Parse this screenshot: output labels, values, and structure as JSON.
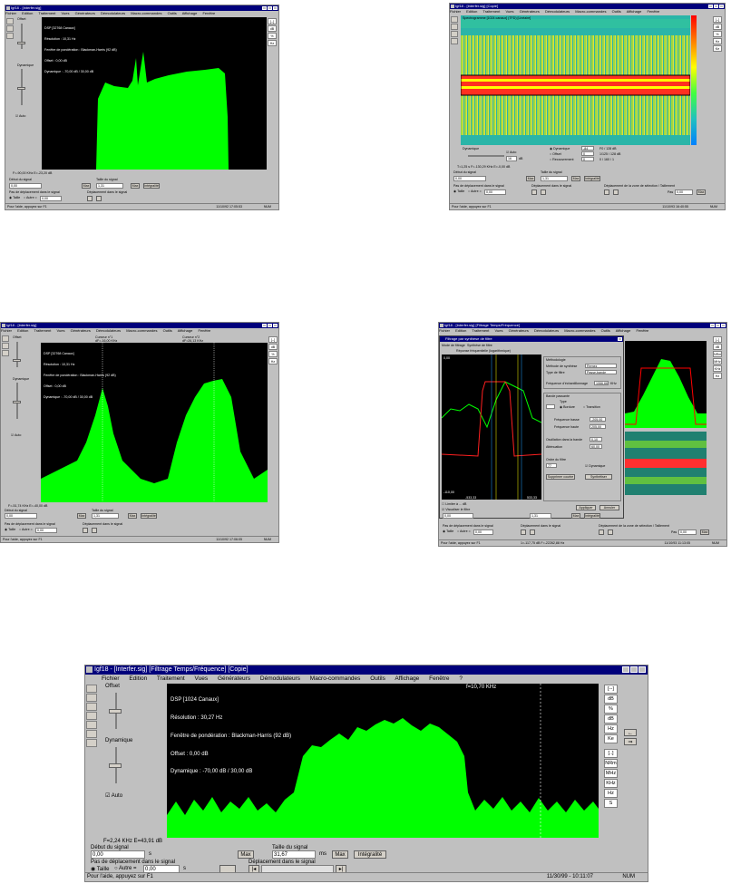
{
  "menu": [
    "Fichier",
    "Edition",
    "Traitement",
    "Vues",
    "Générateurs",
    "Démodulateurs",
    "Macro-commandes",
    "Outils",
    "Affichage",
    "Fenêtre",
    "?"
  ],
  "right_buttons": [
    "[--]",
    "dB",
    "%",
    "dB",
    "Hz",
    "Ke",
    "[..]",
    "NRm",
    "MHz",
    "KHz",
    "Hz",
    "S"
  ],
  "status_help": "Pour l'aide, appuyez sur F1",
  "status_num": "NUM",
  "windows": [
    {
      "title": "Igf18 - [Interfer.sig]",
      "offset_label": "Offset",
      "dynamic_label": "Dynamique",
      "auto_label": "Auto",
      "overlay": [
        "DSP [32768 Canaux]",
        "Résolution : 10,31 Hz",
        "Fenêtre de pondération : Blackman-Harris (92 dB)",
        "Offset : 0,00 dB",
        "Dynamique : -70,00 dB / 30,00 dB"
      ],
      "cursor_readout": "F=-90,00 KHz  E=-23,20 dB",
      "debut_label": "Début du signal",
      "debut_value": "0,00",
      "taille_label": "Taille du signal",
      "taille_value": "1,31",
      "max_btn": "Max",
      "integ_btn": "Intégralité",
      "pas_label": "Pas de déplacement dans le signal",
      "taille_radio": "Taille",
      "autre_radio": "Autre =",
      "pas_value": "0,00",
      "depl_label": "Déplacement dans le signal",
      "time": "11/10/92 17:05:53"
    },
    {
      "title": "Igf18 - [Interfer.sig] [Copie]",
      "spectro_header": "Spectrogramme [1024 canaux] (TFD) [Linéaire]",
      "dynamic_label": "Dynamique",
      "auto_label": "Auto",
      "dyn_value": "16",
      "db_unit": "dB",
      "mode1": "Dynamique",
      "mode2": "Offset",
      "mode3": "Recouvrement",
      "v1": "-84",
      "v2": "0",
      "v3": "0",
      "info1": "F0 / 128 dB",
      "info2": "1/125 / 128 dB",
      "info3": "0 / 160 / 1",
      "cursor_readout": "T=1,25 s  F=-130,29 KHz  E=-0,00 dB",
      "debut_label": "Début du signal",
      "debut_value": "0,00",
      "taille_label": "Taille du signal",
      "taille_value": "1,31",
      "max_btn": "Max",
      "integ_btn": "Intégralité",
      "pas_label": "Pas de déplacement dans le signal",
      "taille_radio": "Taille",
      "autre_radio": "Autre =",
      "pas_value": "0,00",
      "depl_label": "Déplacement dans le signal",
      "zone_label": "Déplacement de la zone de sélection / Taillement",
      "pas_short": "Pas",
      "zone_value": "0,00",
      "time": "11/10/93 16:40:55"
    },
    {
      "title": "Igf18 - [Interfer.sig]",
      "offset_label": "Offset",
      "dynamic_label": "Dynamique",
      "auto_label": "Auto",
      "cursor1": "Curseur n°1",
      "cursor1_f": "dF=-16,00 KHz",
      "cursor2": "Curseur n°2",
      "cursor2_f": "dF=26,13 KHz",
      "overlay": [
        "DSP [32768 Canaux]",
        "Résolution : 10,31 Hz",
        "Fenêtre de pondération : Blackman-Harris (92 dB)",
        "Offset : 0,00 dB",
        "Dynamique : -70,00 dB / 30,00 dB"
      ],
      "cursor_readout": "F=-51,74 KHz  E=-40,00 dB",
      "debut_label": "Début du signal",
      "debut_value": "0,00",
      "taille_label": "Taille du signal",
      "taille_value": "1,31",
      "max_btn": "Max",
      "integ_btn": "Intégralité",
      "pas_label": "Pas de déplacement dans le signal",
      "taille_radio": "Taille",
      "autre_radio": "Autre =",
      "pas_value": "0,00",
      "depl_label": "Déplacement dans le signal",
      "time": "11/10/92 17:06:05"
    },
    {
      "title": "Igf18 - [Interfer.sig] [Filtrage Temps/Fréquence]",
      "dialog_title": "Filtrage par synthèse de filtre",
      "dialog_tab1": "Mode de filtrage",
      "dialog_tab2": "Synthèse de filtre",
      "resp_label": "Réponse fréquentielle (logarithmique)",
      "method_group": "Méthodologie",
      "method_label": "Méthode de synthèse",
      "method_value": "Remez",
      "type_label": "Type de filtre",
      "type_value": "Passe-bande",
      "freq_label": "Fréquence d'échantillonnage",
      "freq_value": "1066,66",
      "freq_unit": "KHz",
      "bande_group": "Bande passante",
      "type2_label": "Type",
      "bordure": "Bordure",
      "transition": "Transition",
      "fbasse_label": "Fréquence basse",
      "fbasse_value": "-205,00",
      "fhaute_label": "Fréquence haute",
      "fhaute_value": "205,00",
      "osc_label": "Oscillation dans la bande",
      "osc_value": "0,10",
      "att_label": "Atténuation",
      "att_value": "60,00",
      "ordre_label": "Ordre du filtre",
      "ordre_value": "77",
      "dynamic_check": "Dynamique",
      "suppr_btn": "Supprimer courbe",
      "synth_btn": "Synthétiser",
      "chk1": "Limiter à ... dB",
      "chk2": "Visualiser le filtre",
      "apply_btn": "Appliquer",
      "cancel_btn": "Annuler",
      "ymax": "0,00",
      "ymin": "-110,00",
      "xmin": "-533,33",
      "xmax": "533,33",
      "cursor_readout": "1=-117,75 dB  F=-22262,88 Hz",
      "debut_value": "0,00",
      "taille_value": "1,31",
      "max_btn": "Max",
      "integ_btn": "Intégralité",
      "pas_label": "Pas de déplacement dans le signal",
      "taille_radio": "Taille",
      "autre_radio": "Autre =",
      "pas_value": "0,00",
      "depl_label": "Déplacement dans le signal",
      "zone_label": "Déplacement de la zone de sélection / Taillement",
      "pas_short": "Pas",
      "zone_value": "0,00",
      "time": "11/10/93 11:13:05"
    },
    {
      "title": "Igf18 - [Interfer.sig] [Filtrage Temps/Fréquence] [Copie]",
      "offset_label": "Offset",
      "dynamic_label": "Dynamique",
      "auto_label": "Auto",
      "cursor_top": "f=10,70 KHz",
      "overlay": [
        "DSP [1024 Canaux]",
        "Résolution : 30,27 Hz",
        "Fenêtre de pondération : Blackman-Harris (92 dB)",
        "Offset : 0,00 dB",
        "Dynamique : -70,00 dB / 30,00 dB"
      ],
      "cursor_readout": "F=2,24 KHz  E=43,91 dB",
      "debut_label": "Début du signal",
      "debut_value": "0,00",
      "debut_unit": "s",
      "taille_label": "Taille du signal",
      "taille_value": "31,67",
      "taille_unit": "ms",
      "max_btn": "Max",
      "integ_btn": "Intégralité",
      "pas_label": "Pas de déplacement dans le signal",
      "taille_radio": "Taille",
      "autre_radio": "Autre =",
      "pas_value": "0,00",
      "pas_unit": "s",
      "depl_label": "Déplacement dans le signal",
      "time": "11/30/99 - 10:11:07"
    }
  ]
}
